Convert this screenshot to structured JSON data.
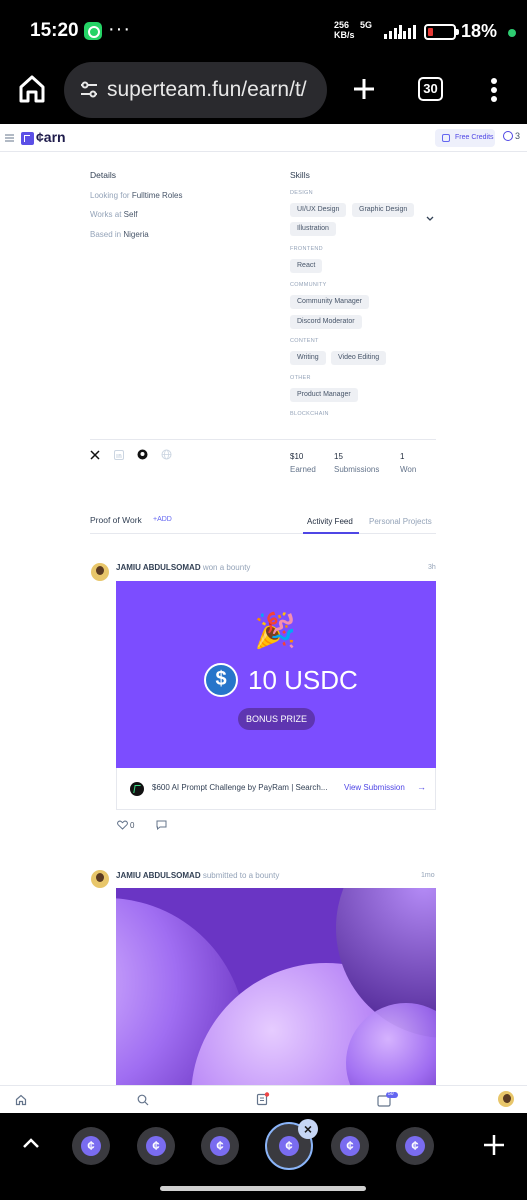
{
  "status_bar": {
    "time": "15:20",
    "more": "···",
    "net_speed_value": "256",
    "net_speed_unit": "KB/s",
    "network_type": "5G",
    "battery_percent": "18%",
    "battery_level": 0.18
  },
  "browser": {
    "url": "superteam.fun/earn/t/",
    "tab_count": "30"
  },
  "navbar": {
    "logo_text": "¢arn",
    "credits_label": "Free Credits",
    "credits_count": "3"
  },
  "details": {
    "title": "Details",
    "looking_prefix": "Looking for",
    "looking_value": "Fulltime Roles",
    "works_prefix": "Works at",
    "works_value": "Self",
    "based_prefix": "Based in",
    "based_value": "Nigeria"
  },
  "skills": {
    "title": "Skills",
    "groups": [
      {
        "category": "DESIGN",
        "chips": [
          "UI/UX Design",
          "Graphic Design",
          "Illustration"
        ]
      },
      {
        "category": "FRONTEND",
        "chips": [
          "React"
        ]
      },
      {
        "category": "COMMUNITY",
        "chips": [
          "Community Manager",
          "Discord Moderator"
        ]
      },
      {
        "category": "CONTENT",
        "chips": [
          "Writing",
          "Video Editing"
        ]
      },
      {
        "category": "OTHER",
        "chips": [
          "Product Manager"
        ]
      },
      {
        "category": "BLOCKCHAIN",
        "chips": []
      }
    ]
  },
  "stats": [
    {
      "value": "$10",
      "label": "Earned"
    },
    {
      "value": "15",
      "label": "Submissions"
    },
    {
      "value": "1",
      "label": "Won"
    }
  ],
  "proof_of_work": {
    "title": "Proof of Work",
    "add_label": "+ADD",
    "tab_activity": "Activity Feed",
    "tab_projects": "Personal Projects"
  },
  "feed": [
    {
      "name": "JAMIU ABDULSOMAD",
      "action": "won a bounty",
      "time": "3h",
      "emoji": "🎉",
      "amount": "10 USDC",
      "badge": "BONUS PRIZE",
      "listing_title": "$600 AI Prompt Challenge by PayRam | Search...",
      "listing_link": "View Submission",
      "likes": "0"
    },
    {
      "name": "JAMIU ABDULSOMAD",
      "action": "submitted to a bounty",
      "time": "1mo"
    }
  ],
  "web_nav": {
    "wallet_badge": "50"
  },
  "colors": {
    "accent": "#4f46e5",
    "prize_card": "#7c4dff",
    "bonus_pill": "#5e35b1",
    "usdc": "#2775ca"
  }
}
